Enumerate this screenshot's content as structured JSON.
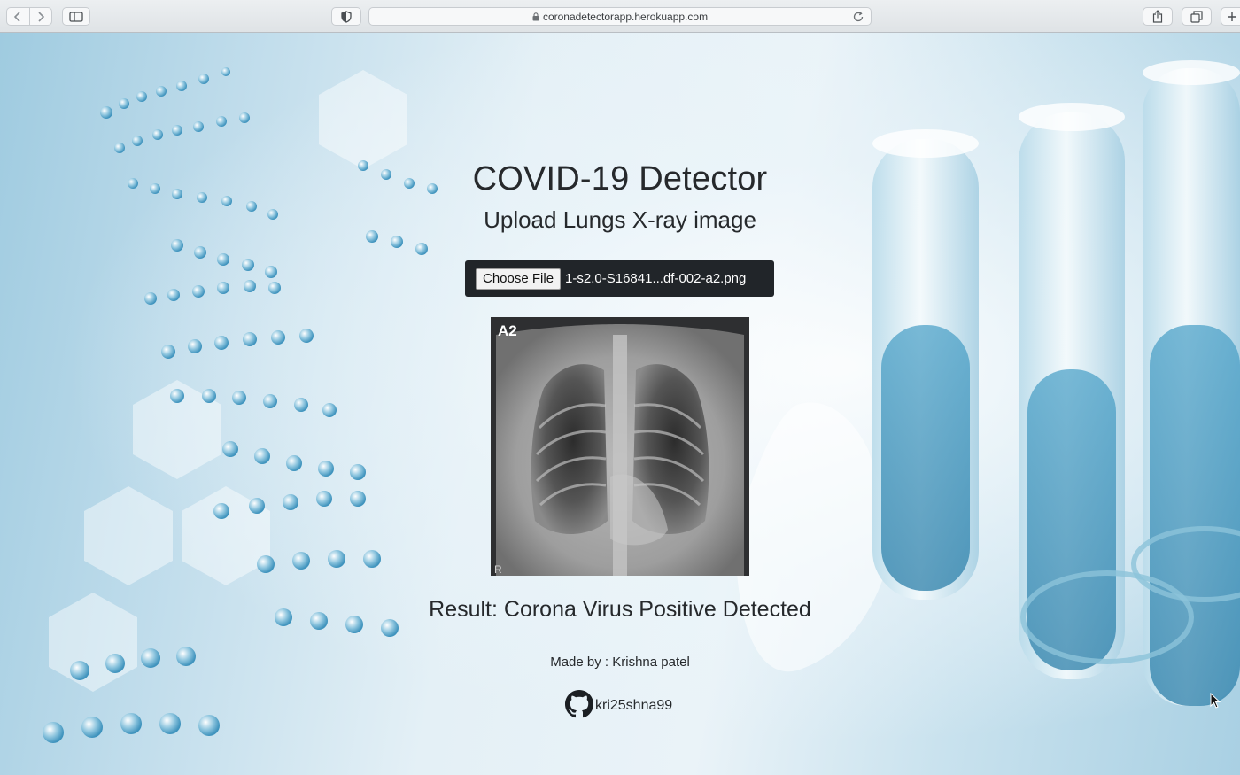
{
  "browser": {
    "url": "coronadetectorapp.herokuapp.com",
    "icons": {
      "back": "chevron-left-icon",
      "forward": "chevron-right-icon",
      "sidebar": "sidebar-icon",
      "privacy": "shield-icon",
      "secure": "lock-icon",
      "reload": "reload-icon",
      "share": "share-icon",
      "tabs": "tabs-overview-icon",
      "new_tab": "plus-icon"
    }
  },
  "page": {
    "title": "COVID-19 Detector",
    "subtitle": "Upload Lungs X-ray image",
    "file_input": {
      "button_label": "Choose File",
      "file_name": "1-s2.0-S16841...df-002-a2.png"
    },
    "xray": {
      "label": "A2",
      "corner_mark": "R"
    },
    "result": "Result: Corona Virus Positive Detected",
    "made_by": "Made by : Krishna patel",
    "github": {
      "icon": "github-icon",
      "username": "kri25shna99"
    }
  },
  "colors": {
    "text": "#26292c",
    "file_box_bg": "#212529",
    "page_tint": "#bfdceb"
  }
}
